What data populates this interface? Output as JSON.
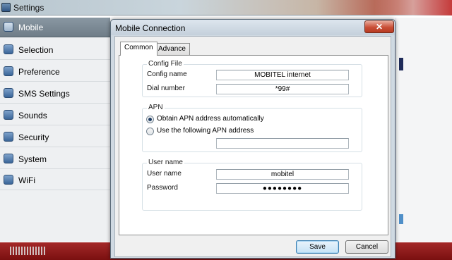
{
  "settings": {
    "title": "Settings",
    "sidebar": [
      {
        "label": "Mobile",
        "icon": "mobile-icon"
      },
      {
        "label": "Selection",
        "icon": "selection-icon"
      },
      {
        "label": "Preference",
        "icon": "preference-icon"
      },
      {
        "label": "SMS Settings",
        "icon": "sms-icon"
      },
      {
        "label": "Sounds",
        "icon": "sound-icon"
      },
      {
        "label": "Security",
        "icon": "security-icon"
      },
      {
        "label": "System",
        "icon": "system-icon"
      },
      {
        "label": "WiFi",
        "icon": "wifi-icon"
      }
    ]
  },
  "dialog": {
    "title": "Mobile Connection",
    "close_label": "✕",
    "tabs": [
      "Common",
      "Advance"
    ],
    "config": {
      "title": "Config File",
      "name_label": "Config name",
      "name_value": "MOBITEL internet",
      "dial_label": "Dial number",
      "dial_value": "*99#"
    },
    "apn": {
      "title": "APN",
      "auto_label": "Obtain APN address automatically",
      "manual_label": "Use the following APN address",
      "address_value": ""
    },
    "user": {
      "title": "User name",
      "username_label": "User name",
      "username_value": "mobitel",
      "password_label": "Password",
      "password_value": "●●●●●●●●"
    },
    "save_label": "Save",
    "cancel_label": "Cancel"
  }
}
